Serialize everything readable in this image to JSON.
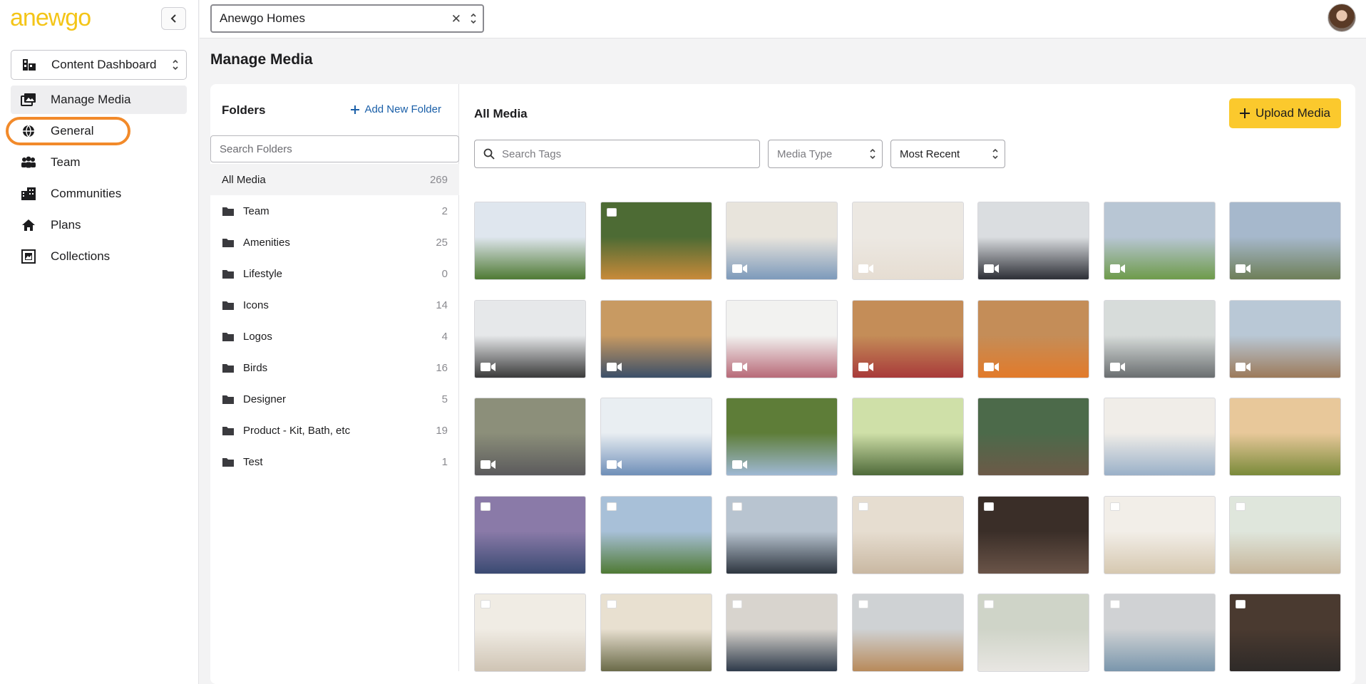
{
  "app": {
    "logo": "anewgo",
    "org_select_value": "Anewgo Homes"
  },
  "sidebar": {
    "dashboard_select": "Content Dashboard",
    "items": [
      {
        "label": "Manage Media",
        "icon": "media-icon",
        "active": true
      },
      {
        "label": "General",
        "icon": "globe-icon",
        "active": false
      },
      {
        "label": "Team",
        "icon": "team-icon",
        "active": false
      },
      {
        "label": "Communities",
        "icon": "communities-icon",
        "active": false
      },
      {
        "label": "Plans",
        "icon": "home-icon",
        "active": false
      },
      {
        "label": "Collections",
        "icon": "collections-icon",
        "active": false
      }
    ]
  },
  "page": {
    "title": "Manage Media"
  },
  "folders": {
    "title": "Folders",
    "add_label": "Add New Folder",
    "search_placeholder": "Search Folders",
    "all_label": "All Media",
    "all_count": "269",
    "items": [
      {
        "name": "Team",
        "count": "2"
      },
      {
        "name": "Amenities",
        "count": "25"
      },
      {
        "name": "Lifestyle",
        "count": "0"
      },
      {
        "name": "Icons",
        "count": "14"
      },
      {
        "name": "Logos",
        "count": "4"
      },
      {
        "name": "Birds",
        "count": "16"
      },
      {
        "name": "Designer",
        "count": "5"
      },
      {
        "name": "Product - Kit, Bath, etc",
        "count": "19"
      },
      {
        "name": "Test",
        "count": "1"
      }
    ]
  },
  "media": {
    "title": "All Media",
    "upload_label": "Upload Media",
    "tag_search_placeholder": "Search Tags",
    "type_select": "Media Type",
    "sort_select": "Most Recent",
    "accent_color": "#fbc92d"
  },
  "thumbnails": [
    {
      "kind": "image",
      "top": "#dfe6ee",
      "bottom": "#4f7a34",
      "label": "white-house-photo"
    },
    {
      "kind": "image",
      "top": "#4d6b34",
      "bottom": "#c88a3a",
      "label": "tree-lined-road-photo"
    },
    {
      "kind": "video",
      "top": "#e8e4dc",
      "bottom": "#7d9abb",
      "label": "man-at-desk-video"
    },
    {
      "kind": "video",
      "top": "#ece8e2",
      "bottom": "#e6ddd2",
      "label": "woman-smiling-video"
    },
    {
      "kind": "video",
      "top": "#dadde0",
      "bottom": "#2d2f36",
      "label": "woman-office-video"
    },
    {
      "kind": "video",
      "top": "#b8c6d4",
      "bottom": "#6e9b4a",
      "label": "woman-neighborhood-video"
    },
    {
      "kind": "video",
      "top": "#a6b8cc",
      "bottom": "#6e7f58",
      "label": "family-group-video"
    },
    {
      "kind": "video",
      "top": "#e6e8ea",
      "bottom": "#3a3a3a",
      "label": "woman-design-studio-video"
    },
    {
      "kind": "video",
      "top": "#c89a62",
      "bottom": "#3b4f68",
      "label": "construction-crew-video"
    },
    {
      "kind": "video",
      "top": "#f2f2f0",
      "bottom": "#b86a78",
      "label": "family-new-home-video"
    },
    {
      "kind": "video",
      "top": "#c48d58",
      "bottom": "#a83a3a",
      "label": "family-framing-video"
    },
    {
      "kind": "video",
      "top": "#c48d58",
      "bottom": "#e27a2a",
      "label": "builder-vest-video"
    },
    {
      "kind": "video",
      "top": "#d7dcda",
      "bottom": "#6a6e70",
      "label": "woman-living-room-video"
    },
    {
      "kind": "video",
      "top": "#b9c8d6",
      "bottom": "#9c7a5a",
      "label": "man-construction-site-video"
    },
    {
      "kind": "video",
      "top": "#8c8f7a",
      "bottom": "#5b5a5c",
      "label": "couple-living-room-video"
    },
    {
      "kind": "video",
      "top": "#e9eef2",
      "bottom": "#6f8fb8",
      "label": "woman-front-yard-video"
    },
    {
      "kind": "video",
      "top": "#5e7d38",
      "bottom": "#9fb8d4",
      "label": "woman-garden-video"
    },
    {
      "kind": "image",
      "top": "#cfe0a8",
      "bottom": "#4f6a3a",
      "label": "couple-walking-photo"
    },
    {
      "kind": "image",
      "top": "#4c6a4a",
      "bottom": "#6c5a48",
      "label": "kids-fishing-photo"
    },
    {
      "kind": "image",
      "top": "#f0ede8",
      "bottom": "#9ab0c8",
      "label": "couple-excited-photo"
    },
    {
      "kind": "image",
      "top": "#e8c89a",
      "bottom": "#7a8a3a",
      "label": "family-field-photo"
    },
    {
      "kind": "folder",
      "top": "#8a7aa8",
      "bottom": "#3a4a72",
      "label": "blue-house-dusk-photo"
    },
    {
      "kind": "folder",
      "top": "#a8c0d8",
      "bottom": "#4f7a34",
      "label": "stone-house-photo"
    },
    {
      "kind": "folder",
      "top": "#b8c4d0",
      "bottom": "#2e3640",
      "label": "dark-modern-house-photo"
    },
    {
      "kind": "folder",
      "top": "#e6ddd0",
      "bottom": "#c9b8a2",
      "label": "living-room-photo"
    },
    {
      "kind": "folder",
      "top": "#3a2e28",
      "bottom": "#6a5448",
      "label": "dining-room-photo"
    },
    {
      "kind": "folder",
      "top": "#f2eee8",
      "bottom": "#d6c8b0",
      "label": "bathroom-tub-photo"
    },
    {
      "kind": "folder",
      "top": "#dfe6dc",
      "bottom": "#c6b59a",
      "label": "dining-nook-photo"
    },
    {
      "kind": "folder",
      "top": "#f0ece4",
      "bottom": "#cfc4b4",
      "label": "fireplace-room-photo"
    },
    {
      "kind": "folder",
      "top": "#e8e0d0",
      "bottom": "#6a6a48",
      "label": "arched-doorway-photo"
    },
    {
      "kind": "folder",
      "top": "#d8d4ce",
      "bottom": "#2e3a4a",
      "label": "navy-vanity-photo"
    },
    {
      "kind": "folder",
      "top": "#cfd2d4",
      "bottom": "#b88a5a",
      "label": "glass-shower-photo"
    },
    {
      "kind": "folder",
      "top": "#cfd4c8",
      "bottom": "#e8e6e2",
      "label": "vessel-sink-photo"
    },
    {
      "kind": "folder",
      "top": "#d0d2d4",
      "bottom": "#7a96ac",
      "label": "bathroom-blue-vanity-photo"
    },
    {
      "kind": "folder",
      "top": "#4a3a30",
      "bottom": "#2e2a28",
      "label": "dark-kitchen-photo"
    }
  ]
}
